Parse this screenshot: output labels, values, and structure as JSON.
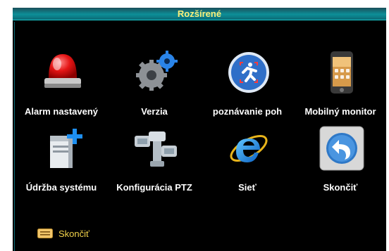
{
  "window": {
    "title": "Rozšírené"
  },
  "menu": {
    "items": [
      {
        "label": "Alarm nastavený",
        "icon": "alarm-siren-icon"
      },
      {
        "label": "Verzia",
        "icon": "gears-icon"
      },
      {
        "label": "poznávanie poh",
        "icon": "motion-detection-icon"
      },
      {
        "label": "Mobilný monitor",
        "icon": "mobile-phone-icon"
      },
      {
        "label": "Údržba systému",
        "icon": "system-maintenance-icon"
      },
      {
        "label": "Konfigurácia PTZ",
        "icon": "ptz-camera-icon"
      },
      {
        "label": "Sieť",
        "icon": "network-e-icon"
      },
      {
        "label": "Skončiť",
        "icon": "exit-arrow-icon"
      }
    ]
  },
  "footer": {
    "exit_label": "Skončiť",
    "icon": "exit-small-icon"
  },
  "colors": {
    "title_text": "#fff07a",
    "titlebar": "#0d8f98",
    "background": "#000000",
    "footer_text": "#f2d24a"
  }
}
